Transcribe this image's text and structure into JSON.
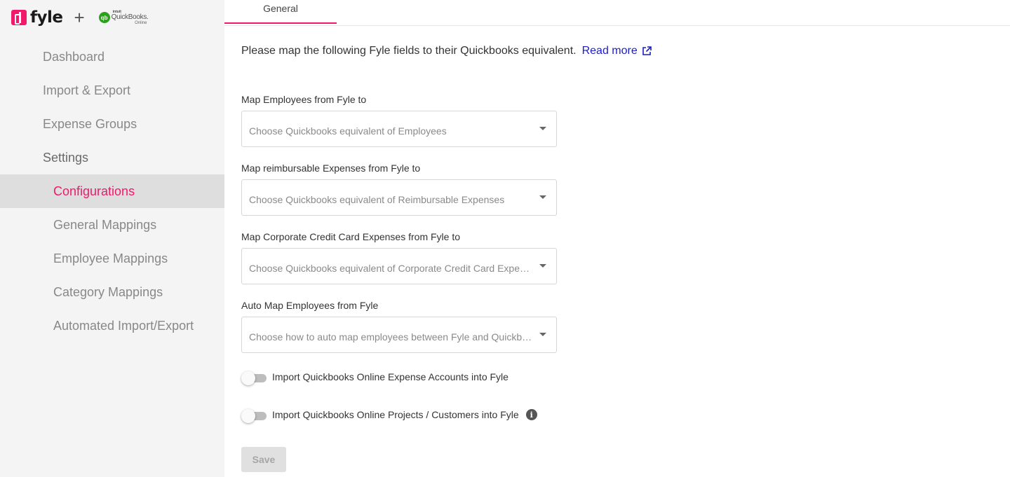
{
  "brand": {
    "app_name": "fyle",
    "plus": "+",
    "qb_intuit": "intuit",
    "qb_name": "QuickBooks.",
    "qb_online": "Online",
    "qb_badge": "qb"
  },
  "nav": {
    "dashboard": "Dashboard",
    "import_export": "Import & Export",
    "expense_groups": "Expense Groups",
    "settings": "Settings",
    "configurations": "Configurations",
    "general_mappings": "General Mappings",
    "employee_mappings": "Employee Mappings",
    "category_mappings": "Category Mappings",
    "automated_import_export": "Automated Import/Export"
  },
  "tabs": {
    "general": "General"
  },
  "intro": {
    "text": "Please map the following Fyle fields to their Quickbooks equivalent.",
    "read_more": "Read more"
  },
  "fields": [
    {
      "label": "Map Employees from Fyle to",
      "placeholder": "Choose Quickbooks equivalent of Employees"
    },
    {
      "label": "Map reimbursable Expenses from Fyle to",
      "placeholder": "Choose Quickbooks equivalent of Reimbursable Expenses"
    },
    {
      "label": "Map Corporate Credit Card Expenses from Fyle to",
      "placeholder": "Choose Quickbooks equivalent of Corporate Credit Card Expenses"
    },
    {
      "label": "Auto Map Employees from Fyle",
      "placeholder": "Choose how to auto map employees between Fyle and Quickbooks"
    }
  ],
  "toggles": [
    {
      "label": "Import Quickbooks Online Expense Accounts into Fyle",
      "on": false
    },
    {
      "label": "Import Quickbooks Online Projects / Customers into Fyle",
      "on": false
    }
  ],
  "save_label": "Save",
  "colors": {
    "accent": "#f0196a",
    "link": "#1c1cc4",
    "sidebar_bg": "#f4f4f4",
    "active_bg": "#dedede",
    "qb_green": "#2ca01c"
  }
}
